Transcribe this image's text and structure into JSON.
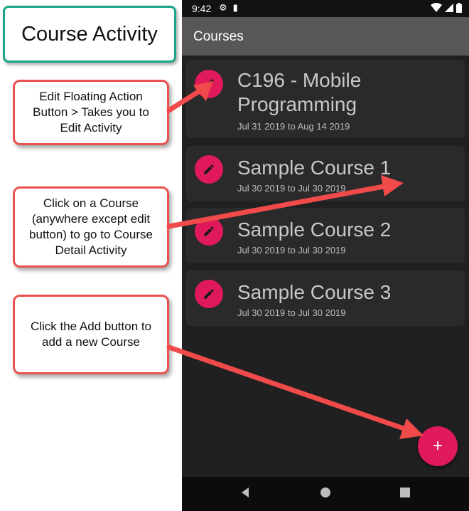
{
  "annotations": {
    "title": "Course Activity",
    "callout_edit": "Edit Floating Action\nButton > Takes you to\nEdit Activity",
    "callout_course": "Click on a Course\n(anywhere except edit\nbutton) to go to Course\nDetail Activity",
    "callout_add": "Click the Add button to\nadd a new Course"
  },
  "status_bar": {
    "time": "9:42"
  },
  "app_bar": {
    "title": "Courses"
  },
  "courses": [
    {
      "title": "C196 - Mobile Programming",
      "dates": "Jul 31 2019 to Aug 14 2019"
    },
    {
      "title": "Sample Course 1",
      "dates": "Jul 30 2019 to Jul 30 2019"
    },
    {
      "title": "Sample Course 2",
      "dates": "Jul 30 2019 to Jul 30 2019"
    },
    {
      "title": "Sample Course 3",
      "dates": "Jul 30 2019 to Jul 30 2019"
    }
  ],
  "fab": {
    "icon": "plus-icon",
    "label": "+"
  },
  "colors": {
    "accent": "#e0195a",
    "callout_border": "#e8524f",
    "title_border": "#1aa58a",
    "arrow": "#f04a4a"
  }
}
